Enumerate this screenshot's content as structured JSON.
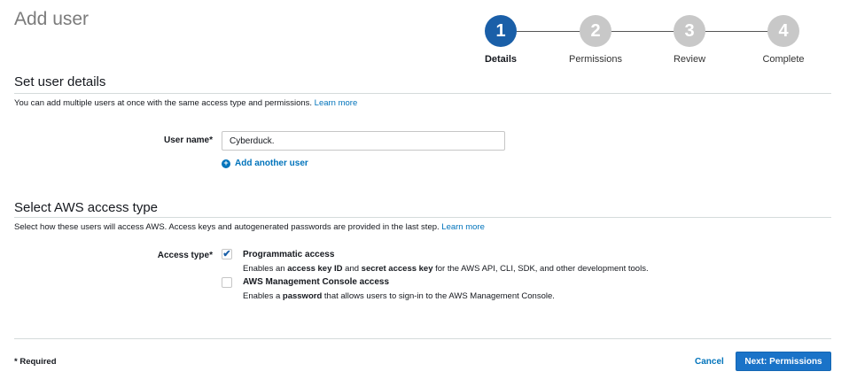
{
  "page": {
    "title": "Add user"
  },
  "steps": [
    {
      "number": "1",
      "label": "Details",
      "active": true
    },
    {
      "number": "2",
      "label": "Permissions",
      "active": false
    },
    {
      "number": "3",
      "label": "Review",
      "active": false
    },
    {
      "number": "4",
      "label": "Complete",
      "active": false
    }
  ],
  "user_details": {
    "title": "Set user details",
    "description": "You can add multiple users at once with the same access type and permissions.",
    "learn_more": "Learn more",
    "user_name_label": "User name*",
    "user_name_value": "Cyberduck.",
    "add_another_user": "Add another user"
  },
  "access_type": {
    "title": "Select AWS access type",
    "description": "Select how these users will access AWS. Access keys and autogenerated passwords are provided in the last step.",
    "learn_more": "Learn more",
    "label": "Access type*",
    "options": [
      {
        "title": "Programmatic access",
        "checked": true,
        "desc_parts": [
          "Enables an ",
          "access key ID",
          " and ",
          "secret access key",
          " for the AWS API, CLI, SDK, and other development tools."
        ]
      },
      {
        "title": "AWS Management Console access",
        "checked": false,
        "desc_parts": [
          "Enables a ",
          "password",
          " that allows users to sign-in to the AWS Management Console."
        ]
      }
    ]
  },
  "footer": {
    "required_note": "* Required",
    "cancel": "Cancel",
    "next": "Next: Permissions"
  },
  "colors": {
    "accent": "#1a5fa8",
    "link": "#0073bb",
    "inactive_step": "#c8c8c8"
  },
  "icons": {
    "add_another_user": "plus-circle-icon",
    "checked": "checkmark-icon"
  }
}
